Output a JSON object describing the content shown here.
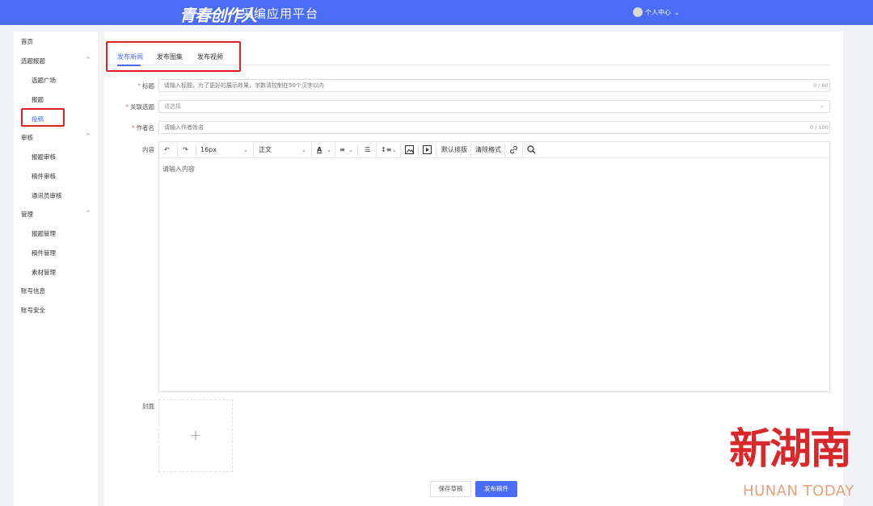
{
  "header": {
    "logo_text": "青春创作人",
    "platform_title": "采编应用平台",
    "user_menu_label": "个人中心",
    "user_menu_icon": "chevron-down-icon"
  },
  "sidebar": {
    "home": "首页",
    "group_topic": {
      "label": "选题报题",
      "items": [
        "选题广场",
        "报题",
        "投稿"
      ]
    },
    "group_review": {
      "label": "审核",
      "items": [
        "报题审核",
        "稿件审核",
        "通讯员审核"
      ]
    },
    "group_manage": {
      "label": "管理",
      "items": [
        "报题管理",
        "稿件管理",
        "素材管理"
      ]
    },
    "account_info": "账号信息",
    "account_security": "账号安全",
    "active_item": "投稿"
  },
  "tabs": [
    "发布新闻",
    "发布图集",
    "发布视频"
  ],
  "active_tab": "发布新闻",
  "form": {
    "title": {
      "label": "标题",
      "placeholder": "请输入标题，为了更好的展示效果，字数请控制在50个汉字以内",
      "count": "0 / 60"
    },
    "topic": {
      "label": "关联选题",
      "placeholder": "请选择"
    },
    "author": {
      "label": "作者名",
      "placeholder": "请输入作者姓名",
      "count": "0 / 100"
    },
    "content": {
      "label": "内容",
      "placeholder": "请输入内容",
      "toolbar": {
        "font_size": "16px",
        "paragraph": "正文",
        "text_color_glyph": "A",
        "default_layout": "默认排版",
        "clear_format": "清除格式"
      }
    },
    "cover": {
      "label": "封面"
    }
  },
  "buttons": {
    "save_draft": "保存草稿",
    "publish": "发布稿件"
  },
  "watermark": {
    "brand": "新湖南",
    "brand_en": "HUNAN TODAY"
  },
  "colors": {
    "primary": "#4a6cf7",
    "highlight_box": "#e02020",
    "watermark_red": "#d8282c"
  }
}
